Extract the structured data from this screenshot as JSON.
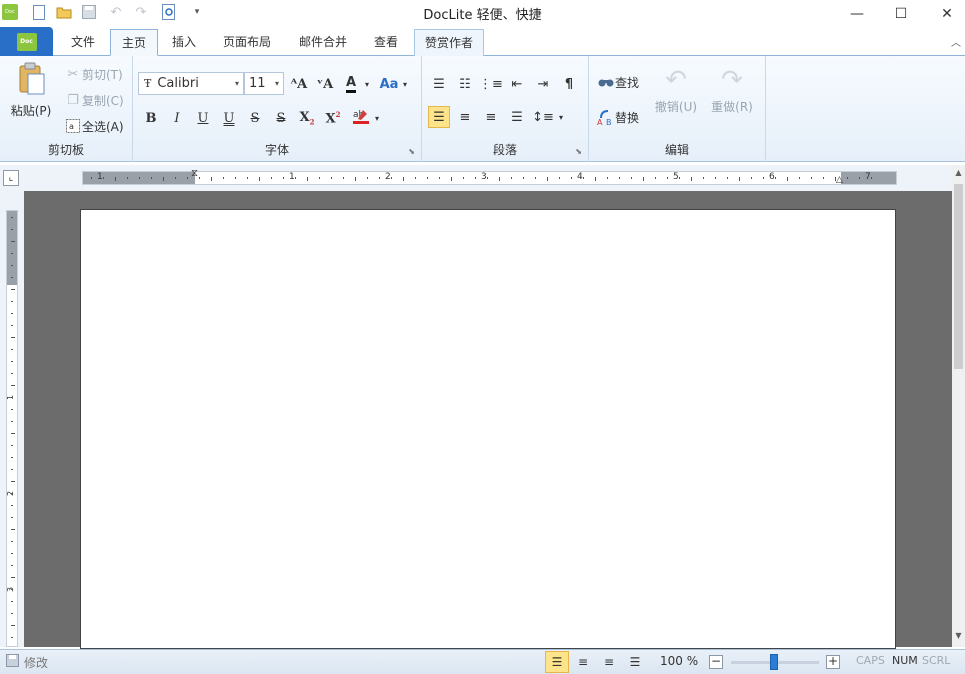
{
  "window": {
    "title": "DocLite  轻便、快捷",
    "minimize_glyph": "—",
    "maximize_glyph": "☐",
    "close_glyph": "✕"
  },
  "app_button": {
    "logo_text": "Doc",
    "color": "#2a6fc7",
    "logo_color": "#8cc63f"
  },
  "tabs": [
    {
      "label": "文件"
    },
    {
      "label": "主页"
    },
    {
      "label": "插入"
    },
    {
      "label": "页面布局"
    },
    {
      "label": "邮件合并"
    },
    {
      "label": "查看"
    },
    {
      "label": "赞赏作者"
    }
  ],
  "ribbon": {
    "clipboard": {
      "label": "剪切板",
      "paste": "粘贴(P)",
      "cut": "剪切(T)",
      "copy": "复制(C)",
      "select_all": "全选(A)"
    },
    "font": {
      "label": "字体",
      "font_name": "Calibri",
      "font_size": "11"
    },
    "paragraph": {
      "label": "段落"
    },
    "edit": {
      "label": "编辑",
      "find": "查找",
      "replace": "替换",
      "undo": "撤销(U)",
      "redo": "重做(R)"
    }
  },
  "ruler": {
    "h_numbers": [
      "1",
      "1",
      "2",
      "3",
      "4",
      "5",
      "6",
      "7"
    ],
    "v_numbers": [
      "1",
      "2",
      "3"
    ]
  },
  "status": {
    "modify": "修改",
    "zoom": "100 %",
    "caps": "CAPS",
    "num": "NUM",
    "scrl": "SCRL"
  },
  "colors": {
    "selected_button": "#fde38a",
    "zoom_thumb": "#2a7ed8",
    "doc_background": "#6c6c6c"
  }
}
